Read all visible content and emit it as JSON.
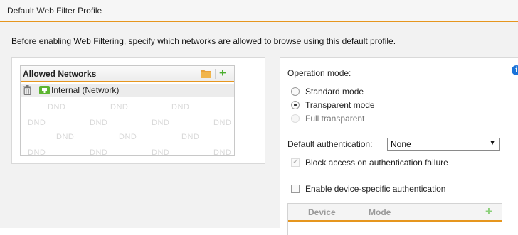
{
  "window": {
    "title": "Default Web Filter Profile"
  },
  "intro_text": "Before enabling Web Filtering, specify which networks are allowed to browse using this default profile.",
  "allowed_networks": {
    "title": "Allowed Networks",
    "items": [
      {
        "label": "Internal (Network)"
      }
    ],
    "dnd_text": "DND",
    "icons": {
      "add": "plus-icon",
      "browse": "folder-icon",
      "delete": "trash-icon",
      "network": "network-icon"
    }
  },
  "operation_mode": {
    "label": "Operation mode:",
    "options": [
      {
        "label": "Standard mode",
        "checked": false,
        "disabled": false
      },
      {
        "label": "Transparent mode",
        "checked": true,
        "disabled": false
      },
      {
        "label": "Full transparent",
        "checked": false,
        "disabled": true
      }
    ],
    "info_icon_text": "i"
  },
  "default_authentication": {
    "label": "Default authentication:",
    "value": "None",
    "dropdown_arrow": "▼"
  },
  "block_access": {
    "label": "Block access on authentication failure",
    "checked": true,
    "disabled": true
  },
  "device_auth": {
    "label": "Enable device-specific authentication",
    "checked": false
  },
  "device_table": {
    "columns": [
      "Device",
      "Mode"
    ],
    "add_symbol": "+"
  },
  "colors": {
    "accent": "#e6961e",
    "add_green": "#4caf30",
    "info_blue": "#1a73d9"
  }
}
